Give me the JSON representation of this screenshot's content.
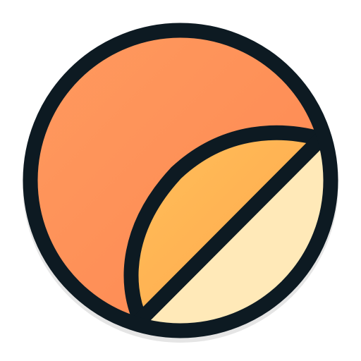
{
  "icon": {
    "name": "sticker-peel-icon",
    "colors": {
      "outline": "#0d1a22",
      "base_light": "#ff9a5e",
      "base_dark": "#fd8752",
      "flap_light": "#ffbf59",
      "flap_dark": "#ffa64d",
      "backing": "#ffe9b8"
    }
  }
}
